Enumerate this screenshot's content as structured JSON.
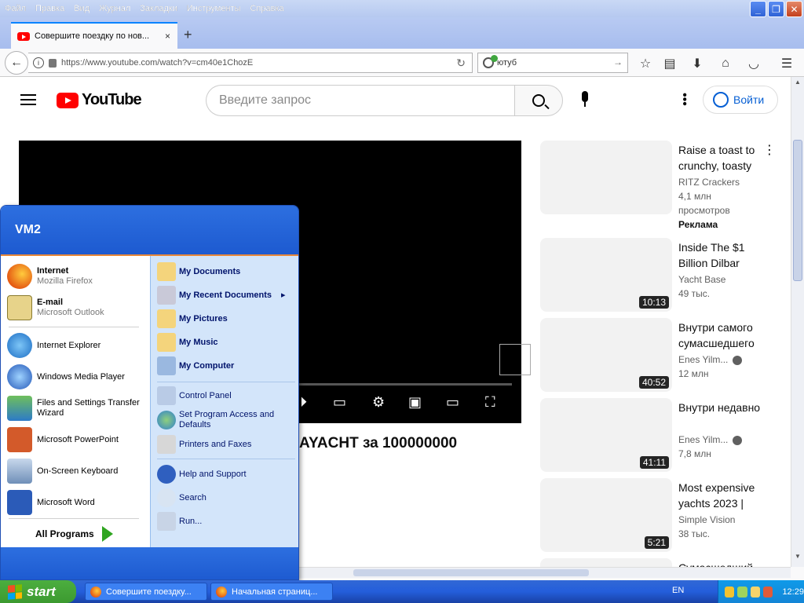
{
  "menubar": {
    "items": [
      "Файл",
      "Правка",
      "Вид",
      "Журнал",
      "Закладки",
      "Инструменты",
      "Справка"
    ]
  },
  "tab": {
    "title": "Совершите поездку по нов...",
    "close": "×",
    "new_tab": "+"
  },
  "navbar": {
    "url": "https://www.youtube.com/watch?v=cm40e1ChozE",
    "search_value": "ютуб"
  },
  "youtube": {
    "logo": "YouTube",
    "search_placeholder": "Введите запрос",
    "signin": "Войти",
    "video_title": "AYACHT за 100000000",
    "recommendations": [
      {
        "title": "Raise a toast to crunchy, toasty",
        "channel": "RITZ Crackers",
        "views_line1": "4,1 млн",
        "views_line2": "просмотров",
        "ad": "Реклама",
        "duration": ""
      },
      {
        "title": "Inside The $1 Billion Dilbar",
        "channel": "Yacht Base",
        "views": "49 тыс.",
        "duration": "10:13"
      },
      {
        "title": "Внутри самого сумасшедшего",
        "channel": "Enes Yilm...",
        "views": "12 млн",
        "duration": "40:52"
      },
      {
        "title": "Внутри недавно",
        "channel": "Enes Yilm...",
        "views": "7,8 млн",
        "duration": "41:11"
      },
      {
        "title": "Most expensive yachts 2023 |",
        "channel": "Simple Vision",
        "views": "38 тыс.",
        "duration": "5:21"
      },
      {
        "title": "Сумасшедший",
        "channel": "",
        "views": "",
        "duration": ""
      }
    ]
  },
  "startmenu": {
    "user": "VM2",
    "pinned": [
      {
        "title": "Internet",
        "subtitle": "Mozilla Firefox"
      },
      {
        "title": "E-mail",
        "subtitle": "Microsoft Outlook"
      }
    ],
    "recent": [
      "Internet Explorer",
      "Windows Media Player",
      "Files and Settings Transfer Wizard",
      "Microsoft PowerPoint",
      "On-Screen Keyboard",
      "Microsoft Word"
    ],
    "all_programs": "All Programs",
    "places": [
      "My Documents",
      "My Recent Documents",
      "My Pictures",
      "My Music",
      "My Computer"
    ],
    "settings": [
      "Control Panel",
      "Set Program Access and Defaults",
      "Printers and Faxes"
    ],
    "help": [
      "Help and Support",
      "Search",
      "Run..."
    ]
  },
  "taskbar": {
    "start": "start",
    "windows": [
      "Совершите поездку...",
      "Начальная страниц..."
    ],
    "language": "EN",
    "clock": "12:29"
  },
  "colors": {
    "yt_red": "#ff0000",
    "xp_blue": "#245edb",
    "xp_green": "#3c9a30",
    "link_blue": "#065fd4"
  }
}
